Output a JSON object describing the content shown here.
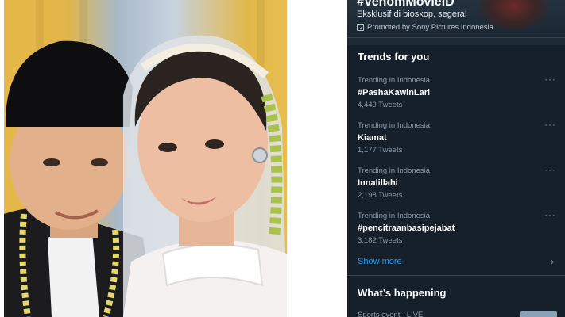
{
  "promo": {
    "title": "#VenomMovieID",
    "description": "Eksklusif di bioskop, segera!",
    "promoted_by": "Promoted by Sony Pictures Indonesia",
    "icon": "promoted-icon"
  },
  "trends": {
    "heading": "Trends for you",
    "items": [
      {
        "context": "Trending in Indonesia",
        "name": "#PashaKawinLari",
        "count": "4,449 Tweets"
      },
      {
        "context": "Trending in Indonesia",
        "name": "Kiamat",
        "count": "1,177 Tweets"
      },
      {
        "context": "Trending in Indonesia",
        "name": "Innalillahi",
        "count": "2,198 Tweets"
      },
      {
        "context": "Trending in Indonesia",
        "name": "#pencitraanbasipejabat",
        "count": "3,182 Tweets"
      }
    ],
    "more_glyph": "···",
    "show_more": "Show more"
  },
  "whats_happening": {
    "heading": "What’s happening",
    "first_context": "Sports event · LIVE"
  },
  "colors": {
    "panel_bg": "#15202b",
    "accent": "#1d9bf0",
    "muted_text": "#8b98a5"
  }
}
